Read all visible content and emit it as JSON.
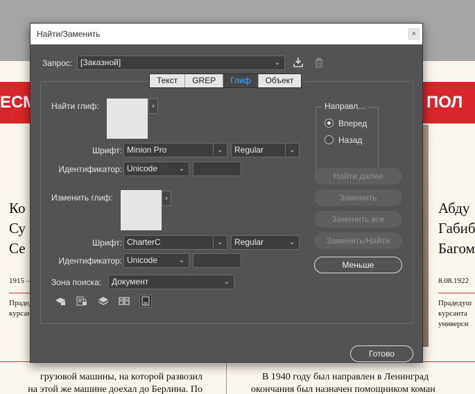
{
  "background": {
    "left_banner": "ЕСМ",
    "right_banner": "ПОЛ",
    "left_name_lines": [
      "Ко",
      "Су",
      "Се"
    ],
    "right_name_lines": [
      "Абду",
      "Габиб",
      "Багом"
    ],
    "left_date": "1915 –",
    "right_date": "8.08.1922",
    "left_caption": [
      "Прадед",
      "курсанта"
    ],
    "right_caption": [
      "Прадедуш",
      "курсанта",
      "универси"
    ],
    "bottom_left": [
      "грузовой машины, на которой развозил",
      "на этой же машине доехал до Берлина. По"
    ],
    "bottom_right": [
      "В 1940 году был направлен в Ленинград",
      "окончания был назначен помощником коман"
    ]
  },
  "dialog": {
    "title": "Найти/Заменить",
    "close_glyph": "×",
    "query_label": "Запрос:",
    "query_value": "[Заказной]",
    "tabs": [
      {
        "label": "Текст",
        "active": false
      },
      {
        "label": "GREP",
        "active": false
      },
      {
        "label": "Глиф",
        "active": true
      },
      {
        "label": "Объект",
        "active": false
      }
    ],
    "find": {
      "label": "Найти глиф:",
      "font_label": "Шрифт:",
      "font_value": "Minion Pro",
      "style_value": "Regular",
      "id_label": "Идентификатор:",
      "id_value": "Unicode",
      "code_value": ""
    },
    "change": {
      "label": "Изменить глиф:",
      "font_label": "Шрифт:",
      "font_value": "CharterC",
      "style_value": "Regular",
      "id_label": "Идентификатор:",
      "id_value": "Unicode",
      "code_value": ""
    },
    "search_zone_label": "Зона поиска:",
    "search_zone_value": "Документ",
    "direction": {
      "title": "Направл...",
      "forward": "Вперед",
      "back": "Назад",
      "selected": "forward"
    },
    "buttons": {
      "find_next": "Найти далее",
      "change": "Заменить",
      "change_all": "Заменить все",
      "change_find": "Заменить/Найти",
      "fewer": "Меньше",
      "done": "Готово"
    },
    "colors": {
      "dialog_bg": "#535353",
      "active_tab_text": "#4ea3ff"
    },
    "zone_icons": [
      "locked-layers-icon",
      "locked-stories-icon",
      "hidden-layers-icon",
      "master-pages-icon",
      "footnotes-icon"
    ]
  }
}
